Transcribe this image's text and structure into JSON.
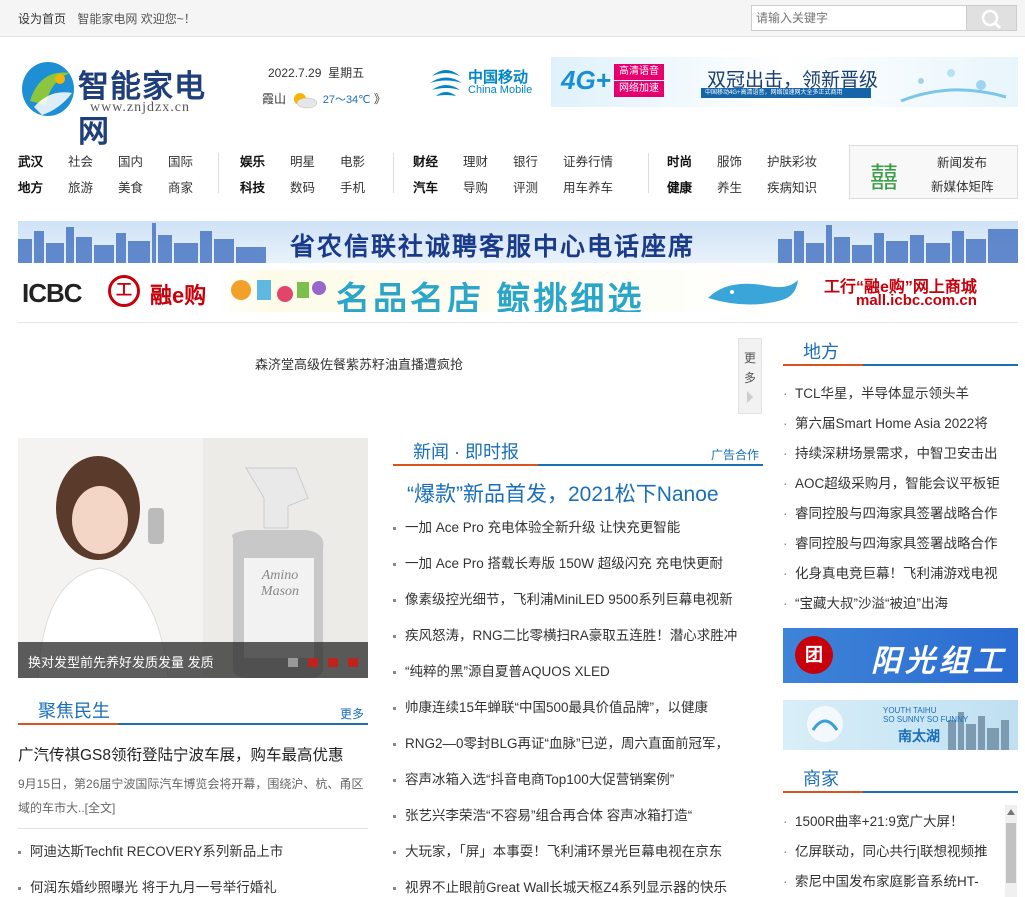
{
  "topbar": {
    "set_home": "设为首页",
    "welcome": "智能家电网 欢迎您~！"
  },
  "search": {
    "placeholder": "请输入关键字"
  },
  "logo": {
    "name": "智能家电网",
    "url": "www.znjdzx.cn"
  },
  "date": {
    "date": "2022.7.29",
    "weekday": "星期五"
  },
  "weather": {
    "city": "霞山",
    "temp": "27～34℃",
    "more": "》"
  },
  "china_mobile": {
    "cn": "中国移动",
    "en": "China Mobile"
  },
  "cm_banner": {
    "g4": "4G+",
    "tag1": "高清语音",
    "tag2": "网络加速",
    "slogan": "双冠出击，领新晋级",
    "sub": "中国移动4G+高清语音，网络加速网大全多正式商用"
  },
  "nav": {
    "col1": [
      [
        "武汉",
        "社会",
        "国内",
        "国际"
      ],
      [
        "地方",
        "旅游",
        "美食",
        "商家"
      ]
    ],
    "col2": [
      [
        "娱乐",
        "明星",
        "电影"
      ],
      [
        "科技",
        "数码",
        "手机"
      ]
    ],
    "col3": [
      [
        "财经",
        "理财",
        "银行",
        "证券行情"
      ],
      [
        "汽车",
        "导购",
        "评测",
        "用车养车"
      ]
    ],
    "col4": [
      [
        "时尚",
        "服饰",
        "护肤彩妆"
      ],
      [
        "健康",
        "养生",
        "疾病知识"
      ]
    ]
  },
  "news_release": {
    "line1": "新闻发布",
    "line2": "新媒体矩阵"
  },
  "banner1": {
    "text": "省农信联社诚聘客服中心电话座席"
  },
  "banner2": {
    "icbc": "ICBC",
    "seal": "工",
    "rong": "融e购",
    "mid": "名品名店 鲸挑细选",
    "right1": "工行“融e购”网上商城",
    "right2": "mall.icbc.com.cn"
  },
  "promo": {
    "text": "森济堂高级佐餐紫苏籽油直播遭疯抢",
    "more": "更多"
  },
  "slide": {
    "caption": "换对发型前先养好发质发量 发质",
    "bottle_brand": "Amino Mason"
  },
  "focus": {
    "title": "聚焦民生",
    "more": "更多",
    "headline": "广汽传祺GS8领衔登陆宁波车展，购车最高优惠",
    "summary": "9月15日，第26届宁波国际汽车博览会将开幕，围绕沪、杭、甬区域的车市大..[全文]",
    "items": [
      "阿迪达斯Techfit RECOVERY系列新品上市",
      "何润东婚纱照曝光 将于九月一号举行婚礼"
    ]
  },
  "news": {
    "title": "新闻 · 即时报",
    "ad": "广告合作",
    "big": "“爆款”新品首发，2021松下Nanoe",
    "items": [
      "一加 Ace Pro 充电体验全新升级 让快充更智能",
      "一加 Ace Pro 搭载长寿版 150W 超级闪充 充电快更耐",
      "像素级控光细节，飞利浦MiniLED 9500系列巨幕电视新",
      "疾风怒涛，RNG二比零横扫RA豪取五连胜！潜心求胜冲",
      "“纯粹的黑”源自夏普AQUOS XLED",
      "帅康连续15年蝉联“中国500最具价值品牌”，以健康",
      "RNG2—0零封BLG再证“血脉”已逆，周六直面前冠军，",
      "容声冰箱入选“抖音电商Top100大促营销案例”",
      "张艺兴李荣浩“不容易”组合再合体 容声冰箱打造“",
      "大玩家，「屏」本事耍！飞利浦环景光巨幕电视在京东",
      "视界不止眼前Great Wall长城天枢Z4系列显示器的快乐"
    ]
  },
  "local": {
    "title": "地方",
    "items": [
      "TCL华星，半导体显示领头羊",
      "第六届Smart Home Asia 2022将",
      "持续深耕场景需求，中智卫安击出",
      "AOC超级采购月，智能会议平板钜",
      "睿同控股与四海家具签署战略合作",
      "睿同控股与四海家具签署战略合作",
      "化身真电竞巨幕！飞利浦游戏电视",
      "“宝藏大叔”沙溢“被迫”出海"
    ]
  },
  "ad_yg": {
    "seal": "团",
    "text": "阳光组工"
  },
  "ad_nth": {
    "en1": "YOUTH TAIHU",
    "en2": "SO SUNNY SO FUNNY",
    "text": "南太湖"
  },
  "shops": {
    "title": "商家",
    "items": [
      "1500R曲率+21:9宽广大屏！",
      "亿屏联动，同心共行|联想视频推",
      "索尼中国发布家庭影音系统HT-"
    ]
  }
}
